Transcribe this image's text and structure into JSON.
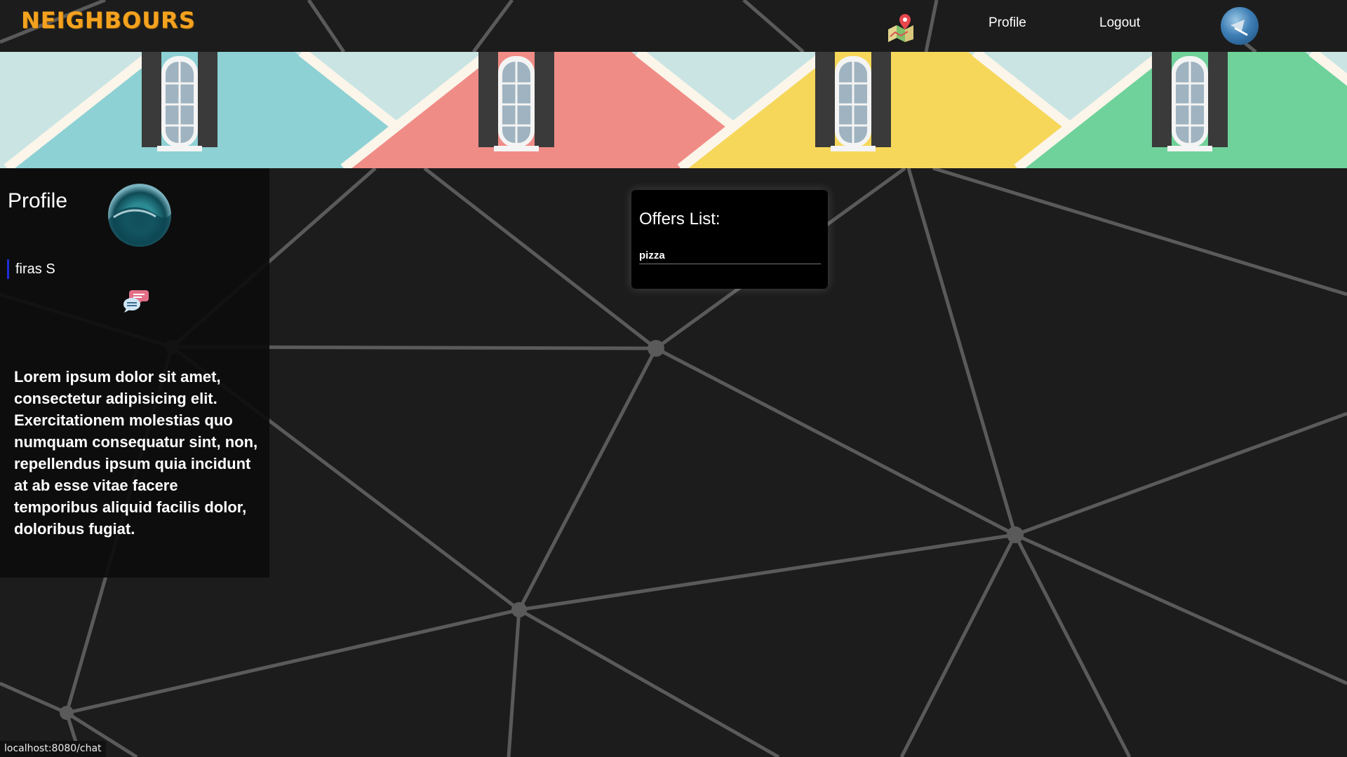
{
  "navbar": {
    "logo": "NEIGHBOURS",
    "map_icon": "map-pin-icon",
    "links": [
      {
        "label": "Profile"
      },
      {
        "label": "Logout"
      }
    ],
    "avatar": "user-avatar"
  },
  "banner": {
    "house_colors": [
      "#8dd1d4",
      "#f08c86",
      "#f6d75a",
      "#6fd29a"
    ]
  },
  "profile": {
    "title": "Profile",
    "username": "firas S",
    "chat_icon": "chat-bubbles-icon",
    "bio": "Lorem ipsum dolor sit amet, consectetur adipisicing elit. Exercitationem molestias quo numquam consequatur sint, non, repellendus ipsum quia incidunt at ab esse vitae facere temporibus aliquid facilis dolor, doloribus fugiat."
  },
  "offers": {
    "title": "Offers List:",
    "items": [
      "pizza"
    ]
  },
  "status_bar": {
    "url": "localhost:8080/chat"
  },
  "colors": {
    "background": "#1c1c1c",
    "logo": "#f4a21f",
    "username_accent": "#1e2fd6",
    "network_lines": "#5a5a5a"
  }
}
